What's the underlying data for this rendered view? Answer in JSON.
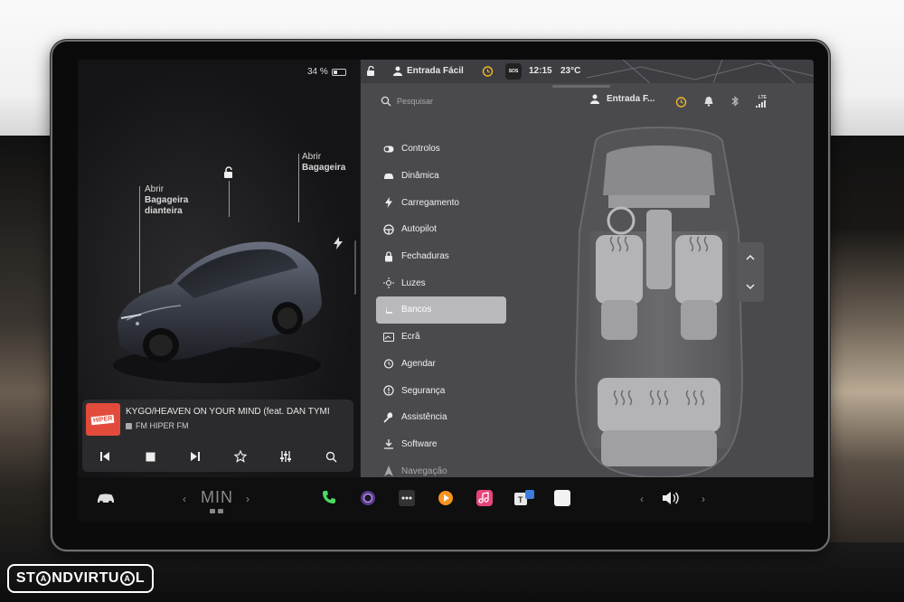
{
  "status": {
    "battery_percent": "34 %",
    "battery_level": 0.34,
    "profile": "Entrada Fácil",
    "time": "12:15",
    "temperature": "23°C",
    "sos": "SOS"
  },
  "car_view": {
    "frunk_label_line1": "Abrir",
    "frunk_label_line2": "Bagageira",
    "frunk_label_line3": "dianteira",
    "trunk_label_line1": "Abrir",
    "trunk_label_line2": "Bagageira",
    "car_color": "#3a3d44"
  },
  "media": {
    "logo_text": "HIPER",
    "title": "KYGO/HEAVEN ON YOUR MIND (feat. DAN TYMI",
    "station": "FM HIPER FM",
    "logo_color": "#e24b3b"
  },
  "search": {
    "placeholder": "Pesquisar"
  },
  "header": {
    "profile_short": "Entrada F...",
    "lte_label": "LTE"
  },
  "menu": {
    "items": [
      {
        "label": "Controlos",
        "icon": "toggle-icon"
      },
      {
        "label": "Dinâmica",
        "icon": "car-icon"
      },
      {
        "label": "Carregamento",
        "icon": "bolt-icon"
      },
      {
        "label": "Autopilot",
        "icon": "steering-wheel-icon"
      },
      {
        "label": "Fechaduras",
        "icon": "lock-icon"
      },
      {
        "label": "Luzes",
        "icon": "sun-icon"
      },
      {
        "label": "Bancos",
        "icon": "seat-icon"
      },
      {
        "label": "Ecrã",
        "icon": "display-icon"
      },
      {
        "label": "Agendar",
        "icon": "alarm-icon"
      },
      {
        "label": "Segurança",
        "icon": "info-icon"
      },
      {
        "label": "Assistência",
        "icon": "wrench-icon"
      },
      {
        "label": "Software",
        "icon": "download-icon"
      },
      {
        "label": "Navegação",
        "icon": "navigation-icon"
      }
    ],
    "active_index": 6
  },
  "taskbar": {
    "climate_text": "MIN",
    "accent_green": "#4cd964"
  }
}
